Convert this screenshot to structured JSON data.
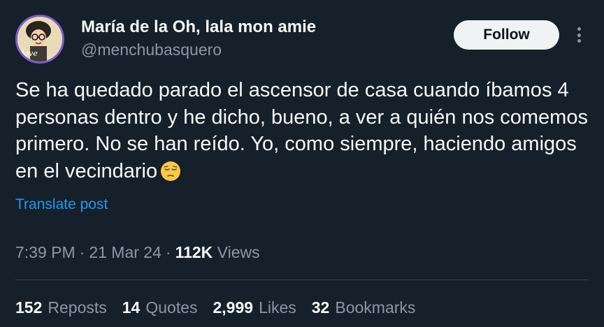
{
  "author": {
    "display_name": "María de la Oh, lala mon amie",
    "handle": "@menchubasquero",
    "avatar_icon": "user-avatar-icon"
  },
  "actions": {
    "follow_label": "Follow",
    "more_icon": "more-options-icon"
  },
  "tweet": {
    "text": "Se ha quedado parado el ascensor de casa cuando íbamos 4 personas dentro y he dicho, bueno, a ver a quién nos comemos primero. No se han reído. Yo, como siempre, haciendo amigos en el vecindario",
    "emoji": "pensive-face-emoji",
    "translate_label": "Translate post"
  },
  "meta": {
    "time": "7:39 PM",
    "separator": "·",
    "date": "21 Mar 24",
    "views_count": "112K",
    "views_label": "Views"
  },
  "stats": [
    {
      "count": "152",
      "label": "Reposts"
    },
    {
      "count": "14",
      "label": "Quotes"
    },
    {
      "count": "2,999",
      "label": "Likes"
    },
    {
      "count": "32",
      "label": "Bookmarks"
    }
  ],
  "colors": {
    "background": "#15202b",
    "text_primary": "#f7f9f9",
    "text_secondary": "#8b98a5",
    "link": "#1d9bf0",
    "divider": "#38444d"
  }
}
